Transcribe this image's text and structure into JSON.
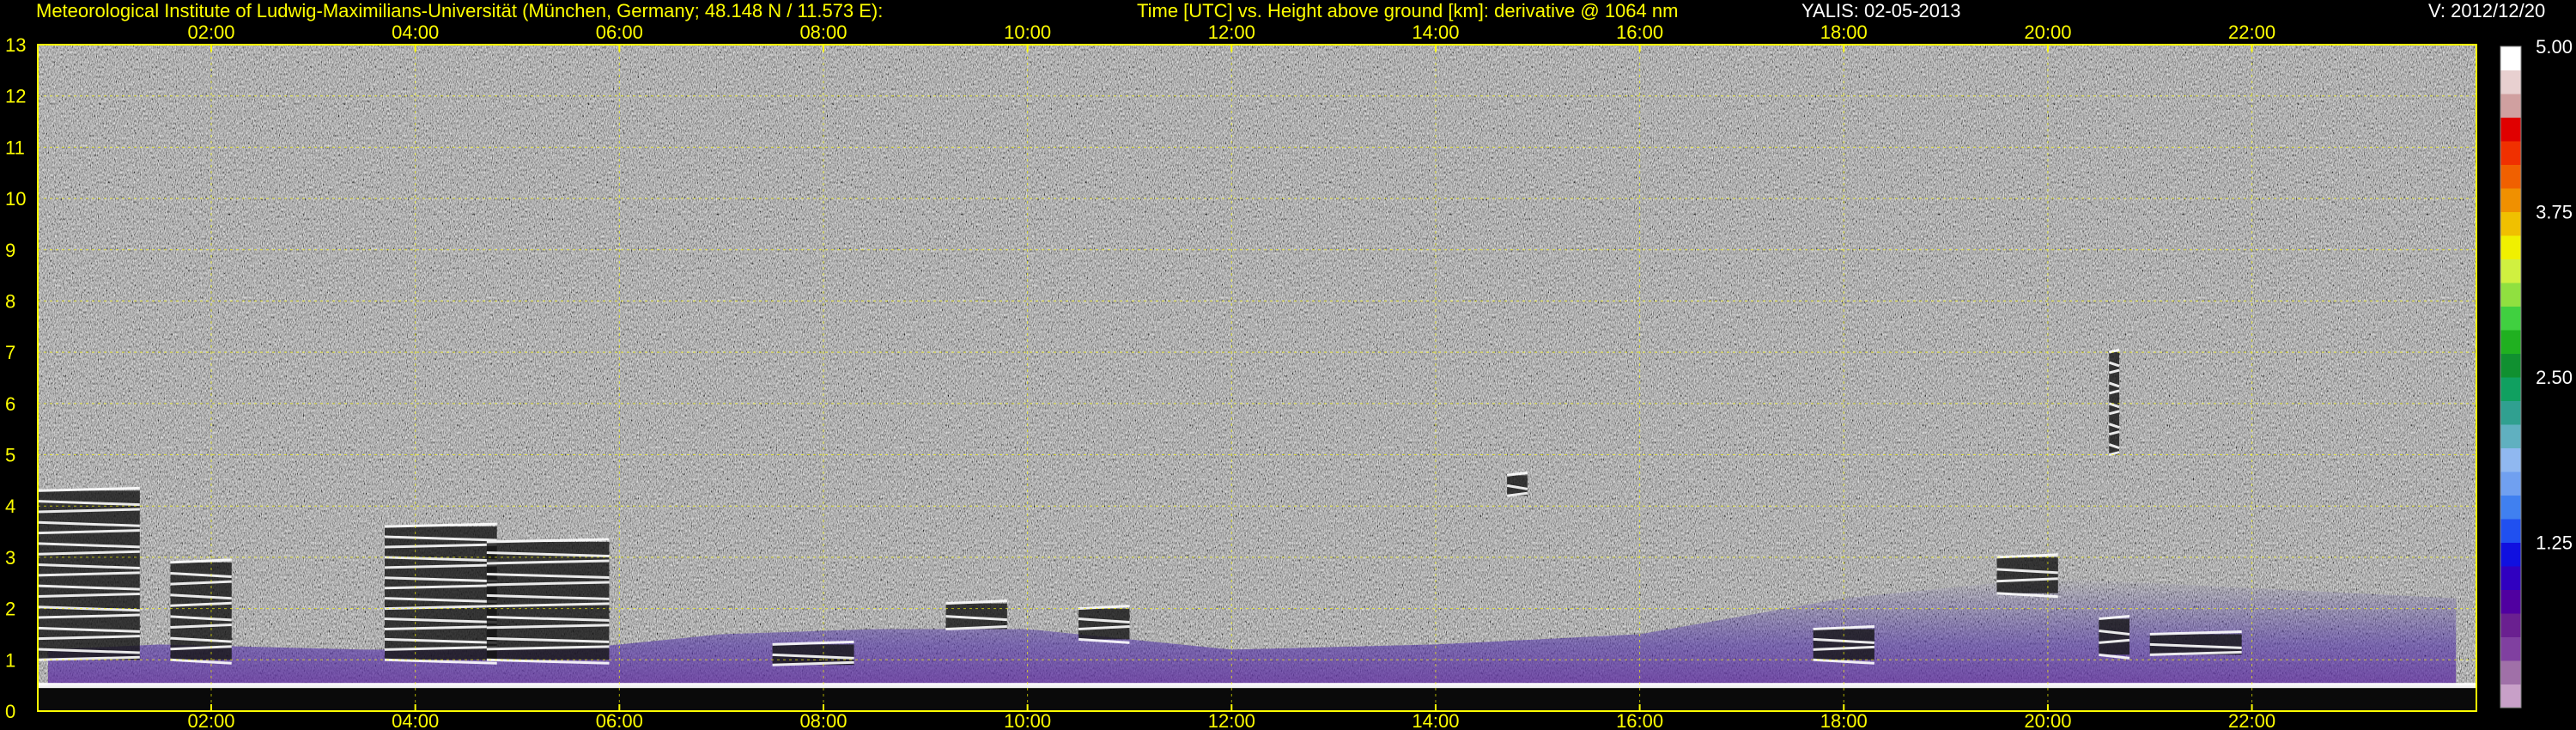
{
  "header": {
    "institute": "Meteorological Institute of Ludwig-Maximilians-Universität (München, Germany; 48.148 N / 11.573 E):",
    "plot_title": "Time [UTC] vs. Height above ground [km]: derivative @ 1064 nm",
    "instrument_date": "YALIS: 02-05-2013",
    "version": "V: 2012/12/20"
  },
  "colors": {
    "background": "#000000",
    "text": "#ffff00",
    "grid": "#ffff00",
    "noise_base": "#8a8a8a",
    "boundary_layer": "#5a2a9a",
    "aerosol_white": "#ffffff"
  },
  "chart_data": {
    "type": "heatmap",
    "title": "Time [UTC] vs. Height above ground [km]: derivative @ 1064 nm",
    "x": {
      "ticks": [
        "02:00",
        "04:00",
        "06:00",
        "08:00",
        "10:00",
        "12:00",
        "14:00",
        "16:00",
        "18:00",
        "20:00",
        "22:00"
      ],
      "tick_hours": [
        2,
        4,
        6,
        8,
        10,
        12,
        14,
        16,
        18,
        20,
        22
      ],
      "range": [
        0.3,
        24.2
      ]
    },
    "y": {
      "ticks": [
        "0",
        "1",
        "2",
        "3",
        "4",
        "5",
        "6",
        "7",
        "8",
        "9",
        "10",
        "11",
        "12",
        "13"
      ],
      "range": [
        0,
        13
      ]
    },
    "colorbar": {
      "tick_labels": [
        "1.25",
        "2.50",
        "3.75",
        "5.00"
      ],
      "tick_values": [
        1.25,
        2.5,
        3.75,
        5.0
      ],
      "range": [
        0,
        5
      ],
      "colors": [
        "#c8a0c8",
        "#a070a8",
        "#8040a0",
        "#6a2090",
        "#5000a0",
        "#3000c0",
        "#1010e0",
        "#2050f0",
        "#4080f0",
        "#70a0f0",
        "#90b8f0",
        "#60b0c0",
        "#30a090",
        "#10a060",
        "#109030",
        "#20b020",
        "#40d040",
        "#90e040",
        "#d0f040",
        "#f0f000",
        "#f0c000",
        "#f09000",
        "#f06000",
        "#f03000",
        "#e00000",
        "#d0a0a0",
        "#e8d0d0",
        "#ffffff"
      ]
    },
    "grid": true,
    "features": {
      "surface_layer": {
        "top_km": 0.5
      },
      "boundary_layer_top_km": [
        [
          0.4,
          1.2
        ],
        [
          1.5,
          1.3
        ],
        [
          3.5,
          1.2
        ],
        [
          5.5,
          1.2
        ],
        [
          7.0,
          1.5
        ],
        [
          8.5,
          1.6
        ],
        [
          10.0,
          1.6
        ],
        [
          12.0,
          1.2
        ],
        [
          14.0,
          1.3
        ],
        [
          16.0,
          1.5
        ],
        [
          18.0,
          2.2
        ],
        [
          20.0,
          2.6
        ],
        [
          22.0,
          2.4
        ],
        [
          24.0,
          2.2
        ]
      ],
      "cloud_patches": [
        {
          "t0": 0.3,
          "t1": 1.3,
          "h0": 1.0,
          "h1": 4.3
        },
        {
          "t0": 1.6,
          "t1": 2.2,
          "h0": 1.0,
          "h1": 2.9
        },
        {
          "t0": 3.7,
          "t1": 4.8,
          "h0": 1.0,
          "h1": 3.6
        },
        {
          "t0": 4.7,
          "t1": 5.9,
          "h0": 1.0,
          "h1": 3.3
        },
        {
          "t0": 7.5,
          "t1": 8.3,
          "h0": 0.9,
          "h1": 1.3
        },
        {
          "t0": 9.2,
          "t1": 9.8,
          "h0": 1.6,
          "h1": 2.1
        },
        {
          "t0": 10.5,
          "t1": 11.0,
          "h0": 1.4,
          "h1": 2.0
        },
        {
          "t0": 14.7,
          "t1": 14.9,
          "h0": 4.2,
          "h1": 4.6
        },
        {
          "t0": 17.7,
          "t1": 18.3,
          "h0": 1.0,
          "h1": 1.6
        },
        {
          "t0": 19.5,
          "t1": 20.1,
          "h0": 2.3,
          "h1": 3.0
        },
        {
          "t0": 20.5,
          "t1": 20.8,
          "h0": 1.1,
          "h1": 1.8
        },
        {
          "t0": 20.6,
          "t1": 20.7,
          "h0": 5.0,
          "h1": 7.0
        },
        {
          "t0": 21.0,
          "t1": 21.9,
          "h0": 1.1,
          "h1": 1.5
        }
      ]
    }
  }
}
